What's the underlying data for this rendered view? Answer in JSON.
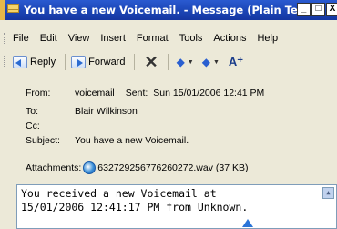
{
  "window": {
    "title": "You have a new Voicemail. - Message (Plain Te...",
    "min_symbol": "_",
    "max_symbol": "□",
    "close_symbol": "X"
  },
  "menu": [
    "File",
    "Edit",
    "View",
    "Insert",
    "Format",
    "Tools",
    "Actions",
    "Help"
  ],
  "toolbar": {
    "reply_label": "Reply",
    "forward_label": "Forward",
    "delete_symbol": "✕",
    "font_symbol": "A⁺"
  },
  "header": {
    "from_label": "From:",
    "from_value": "voicemail",
    "sent_label": "Sent:",
    "sent_value": "Sun 15/01/2006 12:41 PM",
    "to_label": "To:",
    "to_value": "Blair Wilkinson",
    "cc_label": "Cc:",
    "cc_value": "",
    "subject_label": "Subject:",
    "subject_value": "You have a new Voicemail.",
    "attachments_label": "Attachments:",
    "attachment_file": "632729256776260272.wav (37 KB)"
  },
  "body": {
    "line1": "You received a new Voicemail at",
    "line2": "15/01/2006 12:41:17 PM from Unknown."
  }
}
